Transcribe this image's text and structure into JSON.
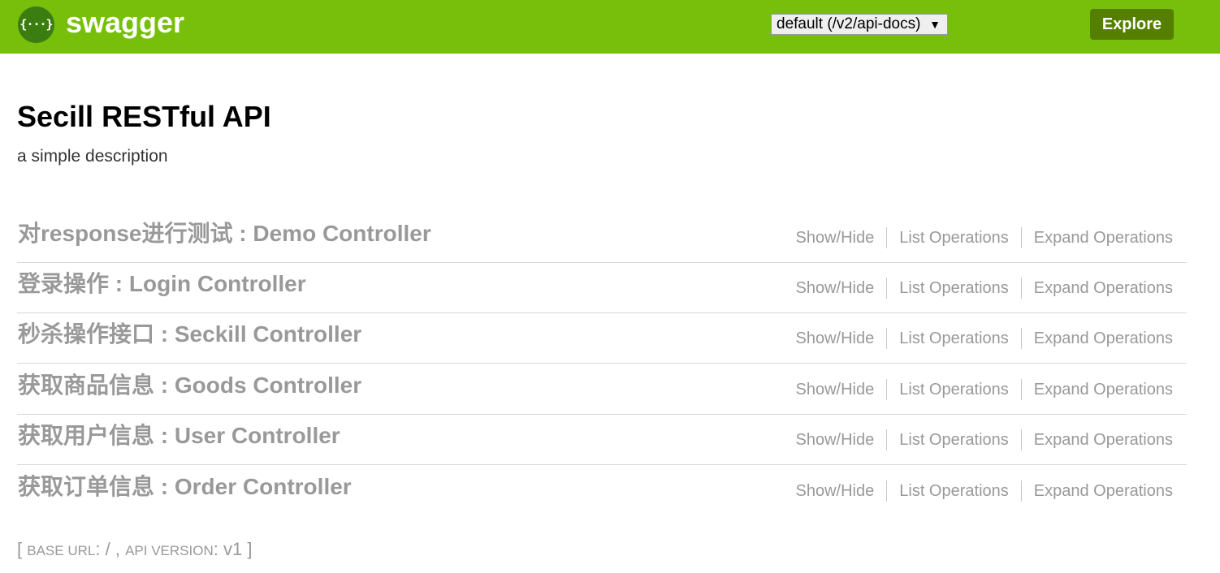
{
  "header": {
    "logo_text": "{···}",
    "brand": "swagger",
    "spec_select": {
      "value": "default (/v2/api-docs)",
      "caret": "▼"
    },
    "explore_label": "Explore",
    "colors": {
      "bar": "#77bf0a",
      "explore_button": "#547f00",
      "logo_bg": "#3c7d11"
    }
  },
  "info": {
    "title": "Secill RESTful API",
    "description": "a simple description"
  },
  "resources": [
    {
      "name": "对response进行测试 : Demo Controller"
    },
    {
      "name": "登录操作 : Login Controller"
    },
    {
      "name": "秒杀操作接口 : Seckill Controller"
    },
    {
      "name": "获取商品信息 : Goods Controller"
    },
    {
      "name": "获取用户信息 : User Controller"
    },
    {
      "name": "获取订单信息 : Order Controller"
    }
  ],
  "operations": {
    "show_hide": "Show/Hide",
    "list": "List Operations",
    "expand": "Expand Operations"
  },
  "footer": {
    "open_bracket": "[",
    "base_url_label": "base url",
    "base_url_value": "/",
    "comma": ",",
    "api_version_label": "api version",
    "api_version_value": "v1",
    "close_bracket": "]"
  }
}
